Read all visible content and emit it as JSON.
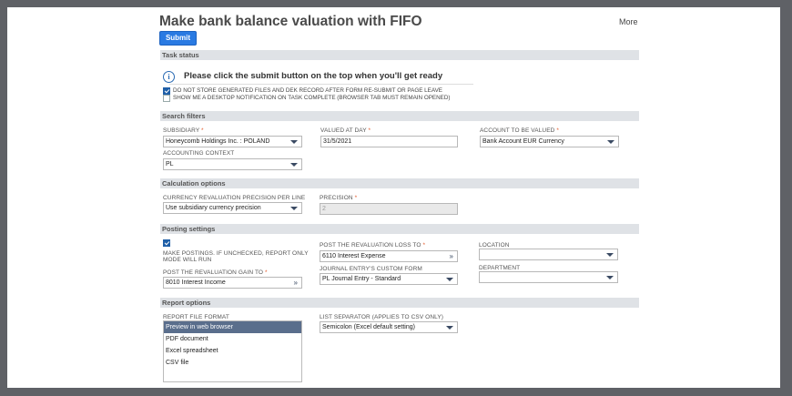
{
  "page": {
    "title": "Make bank balance valuation with FIFO",
    "more_label": "More",
    "submit_label": "Submit"
  },
  "task_status": {
    "section_label": "Task status",
    "info_text": "Please click the submit button on the top when you'll get ready",
    "do_not_store_label": "DO NOT STORE GENERATED FILES AND DEK RECORD AFTER FORM RE-SUBMIT OR PAGE LEAVE",
    "do_not_store_checked": true,
    "notify_label": "SHOW ME A DESKTOP NOTIFICATION ON TASK COMPLETE (BROWSER TAB MUST REMAIN OPENED)",
    "notify_checked": false
  },
  "search_filters": {
    "section_label": "Search filters",
    "subsidiary_label": "SUBSIDIARY",
    "subsidiary_value": "Honeycomb Holdings Inc. : POLAND",
    "valued_at_day_label": "VALUED AT DAY",
    "valued_at_day_value": "31/5/2021",
    "account_label": "ACCOUNT TO BE VALUED",
    "account_value": "Bank Account EUR Currency",
    "accounting_context_label": "ACCOUNTING CONTEXT",
    "accounting_context_value": "PL",
    "required_mark": "*"
  },
  "calculation": {
    "section_label": "Calculation options",
    "precision_per_line_label": "CURRENCY REVALUATION PRECISION PER LINE",
    "precision_per_line_value": "Use subsidiary currency precision",
    "precision_label": "PRECISION",
    "precision_value": "2"
  },
  "posting": {
    "section_label": "Posting settings",
    "make_postings_checked": true,
    "make_postings_label_1": "MAKE POSTINGS. IF UNCHECKED, REPORT ONLY",
    "make_postings_label_2": "MODE WILL RUN",
    "gain_label": "POST THE REVALUATION GAIN TO",
    "gain_value": "8010 Interest Income",
    "loss_label": "POST THE REVALUATION LOSS TO",
    "loss_value": "6110 Interest Expense",
    "custom_form_label": "JOURNAL ENTRY'S CUSTOM FORM",
    "custom_form_value": "PL Journal Entry - Standard",
    "location_label": "LOCATION",
    "location_value": "",
    "department_label": "DEPARTMENT",
    "department_value": ""
  },
  "report": {
    "section_label": "Report options",
    "file_format_label": "REPORT FILE FORMAT",
    "file_formats": [
      "Preview in web browser",
      "PDF document",
      "Excel spreadsheet",
      "CSV file"
    ],
    "selected_index": 0,
    "separator_label": "LIST SEPARATOR (APPLIES TO CSV ONLY)",
    "separator_value": "Semicolon (Excel default setting)"
  },
  "colors": {
    "accent": "#2a7ae2",
    "section_bg": "#dfe2e6",
    "required": "#e25b2c",
    "selected_row": "#5a6e8c",
    "frame": "#5f6166"
  }
}
